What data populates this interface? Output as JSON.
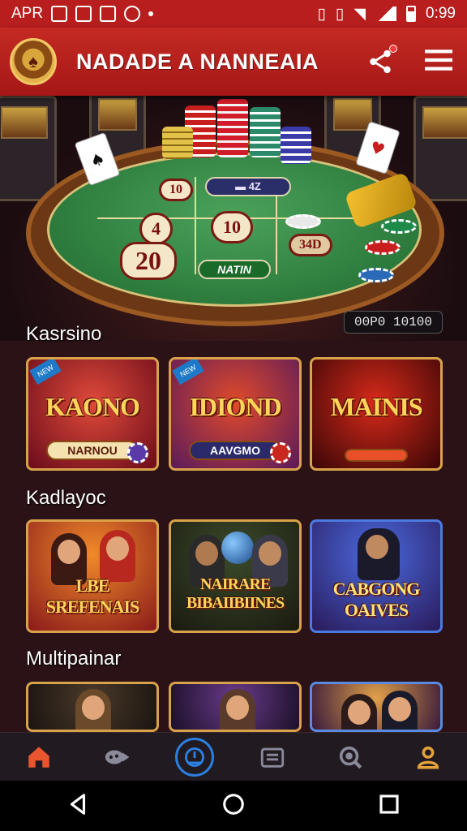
{
  "status_bar": {
    "left_text": "APR",
    "time": "0:99"
  },
  "app_bar": {
    "title": "NADADE A NANNEAIA",
    "logo_glyph": "♠",
    "share_icon": "share-icon",
    "menu_icon": "hamburger-menu-icon"
  },
  "hero": {
    "bets": [
      "10",
      "4",
      "20",
      "10"
    ],
    "pill_top": "▬ 4Z",
    "pill_bottom": "NATIN",
    "chip_label": "34D",
    "counter": "00P0 10100"
  },
  "sections": [
    {
      "title": "Kasrsino",
      "games": [
        {
          "name": "KAONO",
          "sub": "NARNOU",
          "badge": "NEW"
        },
        {
          "name": "IDIOND",
          "sub": "AAVGMO",
          "badge": "NEW"
        },
        {
          "name": "MAINIS",
          "sub": "",
          "badge": ""
        }
      ]
    },
    {
      "title": "Kadlayoc",
      "games": [
        {
          "name": "LBE SREFENAIS",
          "sub": "",
          "badge": ""
        },
        {
          "name": "NAIRARE BIBAIIBIINES",
          "sub": "",
          "badge": ""
        },
        {
          "name": "CABGONG OAIVES",
          "sub": "",
          "badge": ""
        }
      ]
    },
    {
      "title": "Multipainar",
      "games": [
        {
          "name": "",
          "sub": "",
          "badge": ""
        },
        {
          "name": "",
          "sub": "",
          "badge": ""
        },
        {
          "name": "",
          "sub": "",
          "badge": ""
        }
      ]
    }
  ],
  "bottom_nav": {
    "items": [
      {
        "icon": "home-icon",
        "active": true,
        "color": "#e8552e"
      },
      {
        "icon": "game-controller-icon",
        "active": false,
        "color": "#8a8a9a"
      },
      {
        "icon": "clock-icon",
        "active": false,
        "color": "#2a7fe0"
      },
      {
        "icon": "list-icon",
        "active": false,
        "color": "#8a8a9a"
      },
      {
        "icon": "search-icon",
        "active": false,
        "color": "#8a8a9a"
      },
      {
        "icon": "profile-icon",
        "active": false,
        "color": "#e3a23a"
      }
    ]
  },
  "colors": {
    "accent": "#c42a22",
    "background": "#2a1216",
    "gold": "#d9a24a"
  }
}
